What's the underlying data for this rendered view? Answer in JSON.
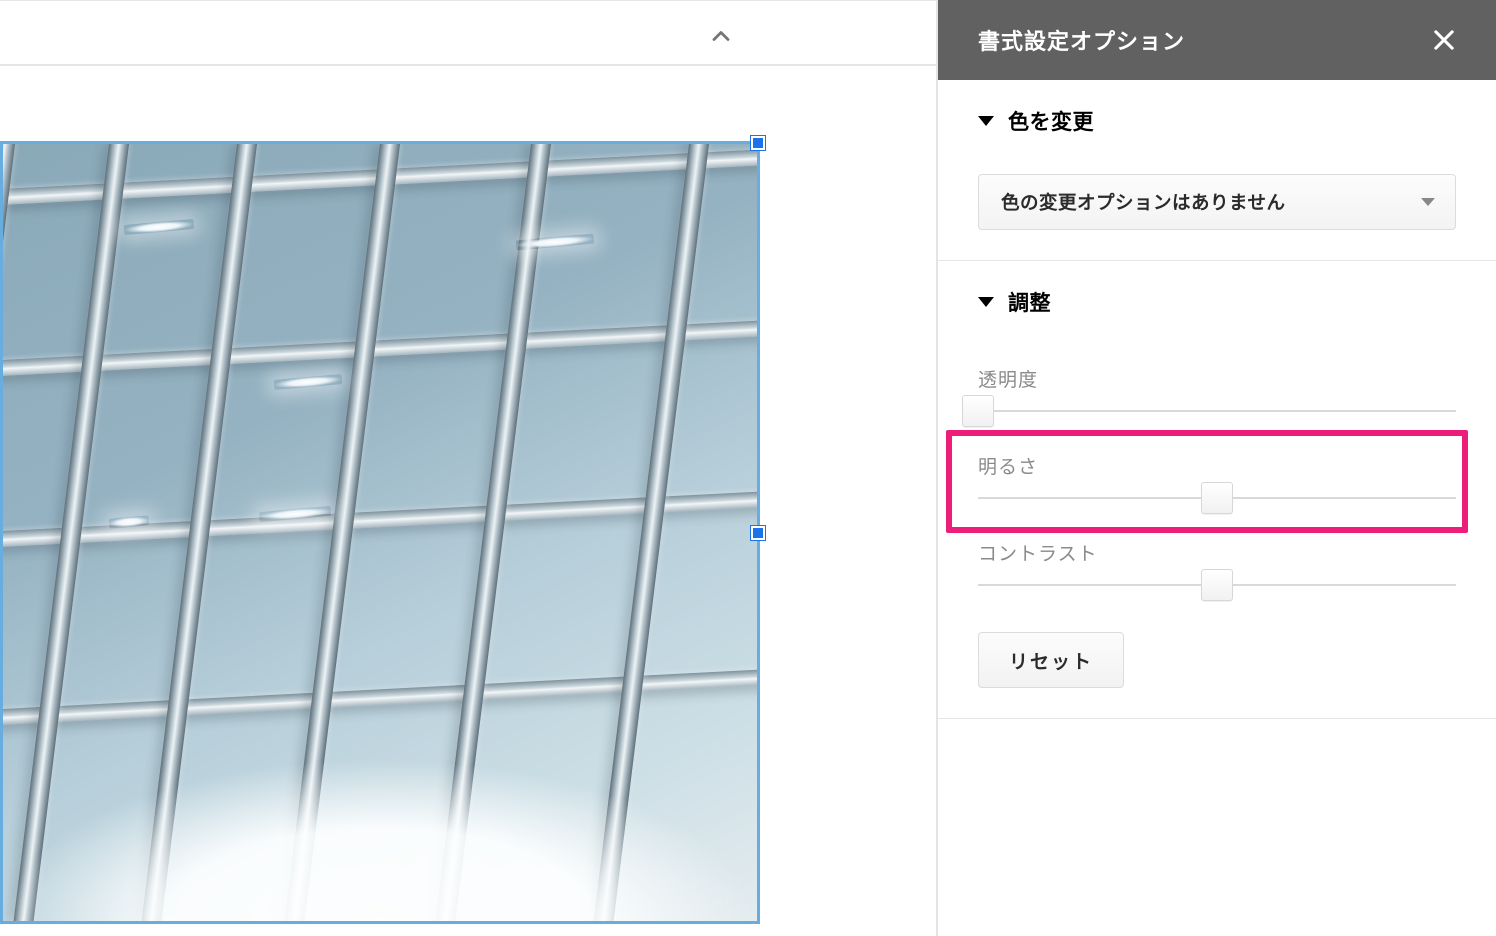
{
  "sidebar": {
    "title": "書式設定オプション",
    "sections": {
      "recolor": {
        "title": "色を変更",
        "select_value": "色の変更オプションはありません"
      },
      "adjust": {
        "title": "調整",
        "sliders": {
          "transparency": {
            "label": "透明度",
            "value_percent": 0
          },
          "brightness": {
            "label": "明るさ",
            "value_percent": 50
          },
          "contrast": {
            "label": "コントラスト",
            "value_percent": 50
          }
        },
        "reset_label": "リセット"
      }
    }
  },
  "highlight": {
    "target": "brightness"
  },
  "colors": {
    "highlight": "#ec1e79",
    "selection": "#1a73e8",
    "sidebar_header": "#616161"
  }
}
